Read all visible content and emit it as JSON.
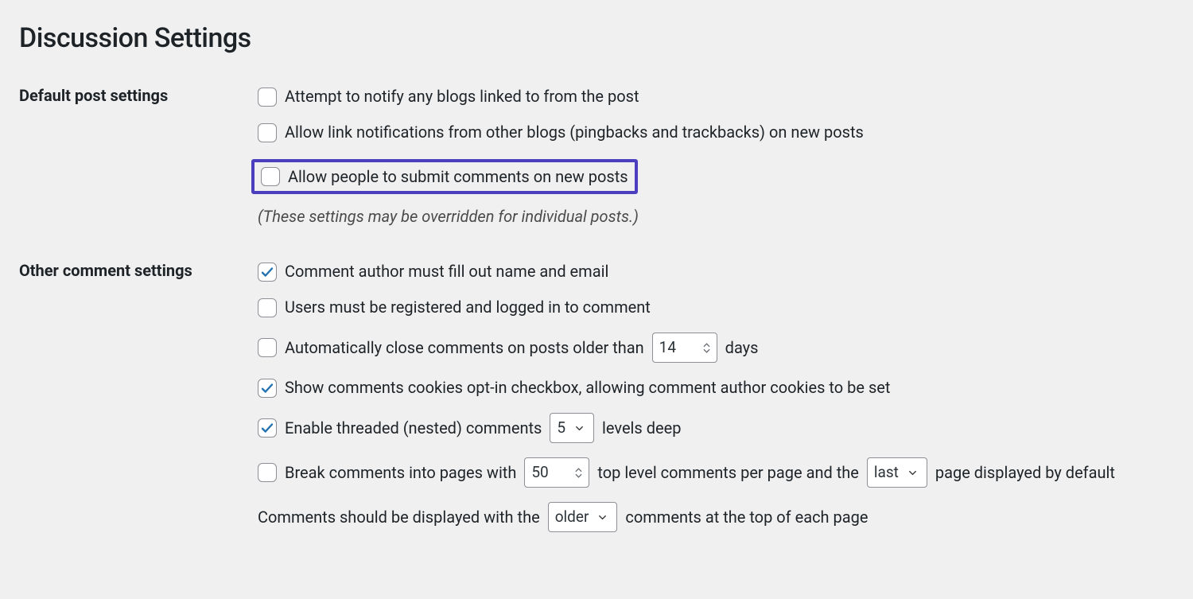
{
  "title": "Discussion Settings",
  "sections": {
    "default_post": {
      "heading": "Default post settings",
      "notify_blogs": {
        "label": "Attempt to notify any blogs linked to from the post",
        "checked": false
      },
      "allow_pingbacks": {
        "label": "Allow link notifications from other blogs (pingbacks and trackbacks) on new posts",
        "checked": false
      },
      "allow_comments": {
        "label": "Allow people to submit comments on new posts",
        "checked": false
      },
      "note": "(These settings may be overridden for individual posts.)"
    },
    "other_comment": {
      "heading": "Other comment settings",
      "require_name_email": {
        "label": "Comment author must fill out name and email",
        "checked": true
      },
      "must_register": {
        "label": "Users must be registered and logged in to comment",
        "checked": false
      },
      "auto_close": {
        "prefix": "Automatically close comments on posts older than",
        "value": "14",
        "suffix": "days",
        "checked": false
      },
      "cookies_optin": {
        "label": "Show comments cookies opt-in checkbox, allowing comment author cookies to be set",
        "checked": true
      },
      "threaded": {
        "prefix": "Enable threaded (nested) comments",
        "value": "5",
        "suffix": "levels deep",
        "checked": true
      },
      "paginate": {
        "prefix": "Break comments into pages with",
        "per_page": "50",
        "mid": "top level comments per page and the",
        "default_page": "last",
        "suffix": "page displayed by default",
        "checked": false
      },
      "order": {
        "prefix": "Comments should be displayed with the",
        "value": "older",
        "suffix": "comments at the top of each page"
      }
    }
  }
}
